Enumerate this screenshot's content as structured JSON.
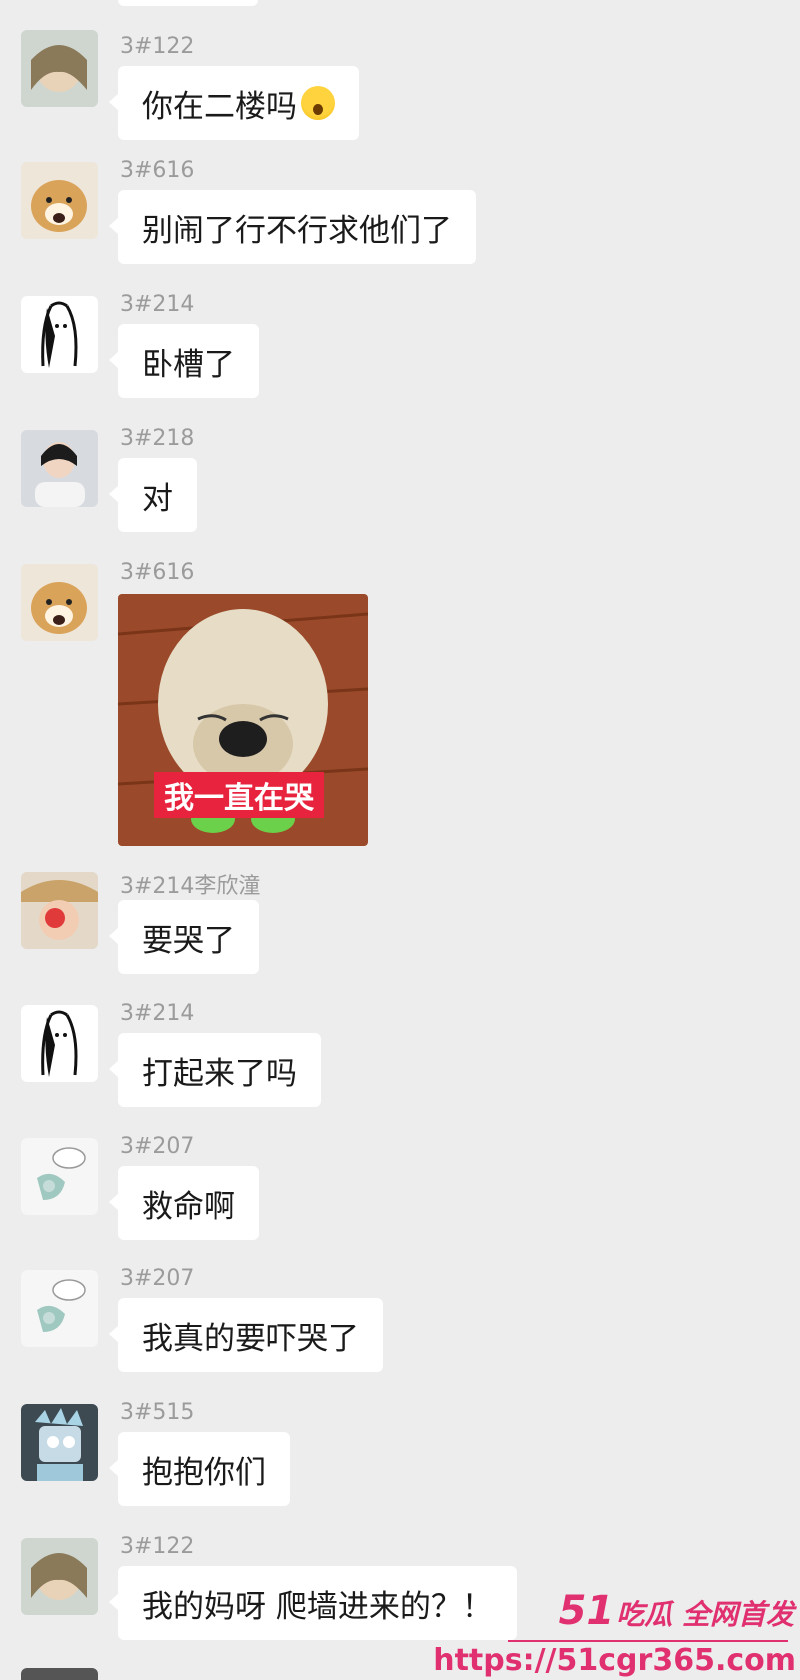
{
  "messages": [
    {
      "sender": "3#122",
      "text": "你在二楼吗",
      "emoji": "screaming-face"
    },
    {
      "sender": "3#616",
      "text": "别闹了行不行求他们了"
    },
    {
      "sender": "3#214",
      "text": "卧槽了"
    },
    {
      "sender": "3#218",
      "text": "对"
    },
    {
      "sender": "3#616",
      "sticker_caption": "我一直在哭"
    },
    {
      "sender": "3#214李欣潼",
      "text": "要哭了"
    },
    {
      "sender": "3#214",
      "text": "打起来了吗"
    },
    {
      "sender": "3#207",
      "text": "救命啊"
    },
    {
      "sender": "3#207",
      "text": "我真的要吓哭了"
    },
    {
      "sender": "3#515",
      "text": "抱抱你们"
    },
    {
      "sender": "3#122",
      "text": "我的妈呀  爬墙进来的？！"
    }
  ],
  "watermark": {
    "brand_number": "51",
    "brand_text": "吃瓜 全网首发",
    "url": "https://51cgr365.com"
  }
}
